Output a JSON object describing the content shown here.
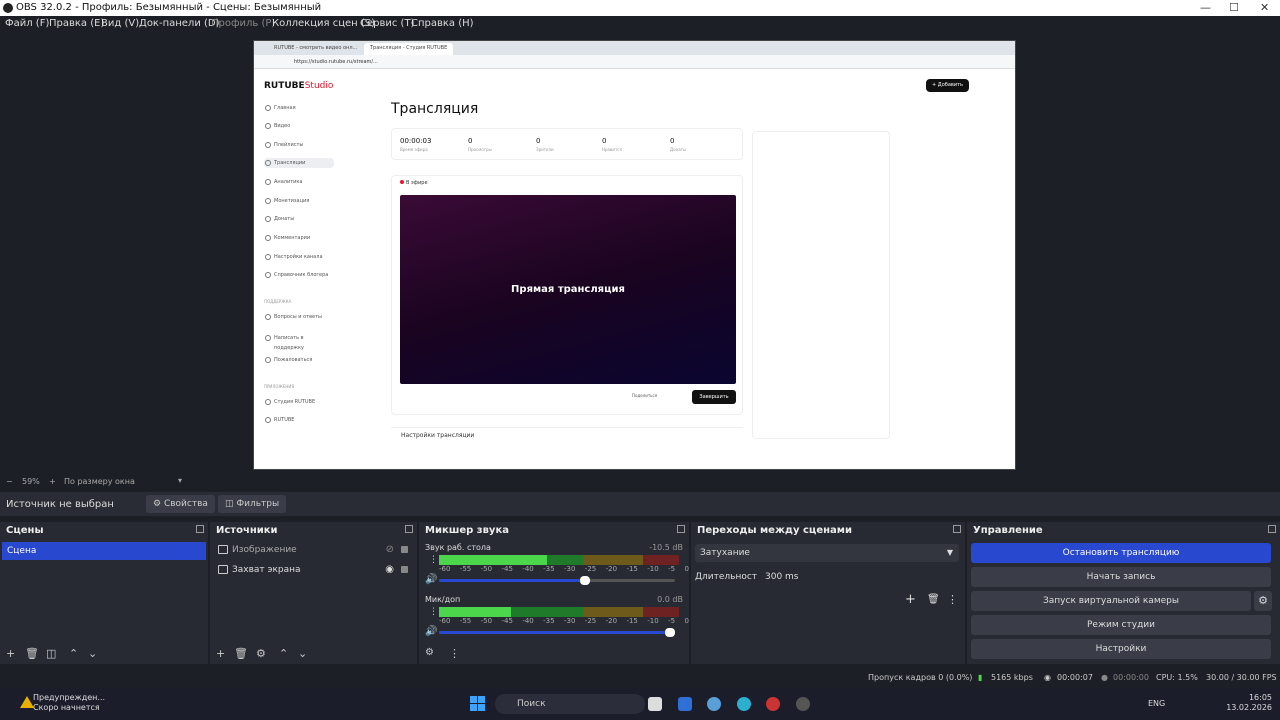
{
  "window": {
    "title": "OBS 32.0.2 - Профиль: Безымянный - Сцены: Безымянный"
  },
  "menu": [
    "Файл (F)",
    "Правка (E)",
    "Вид (V)",
    "Док-панели (D)",
    "Профиль (P)",
    "Коллекция сцен (S)",
    "Сервис (T)",
    "Справка (H)"
  ],
  "preview": {
    "browser_tab1": "RUTUBE - смотреть видео онл...",
    "browser_tab2": "Трансляция - Студия RUTUBE",
    "url": "https://studio.rutube.ru/stream/...",
    "logo_main": "RUTUBE",
    "logo_accent": "Studio",
    "add_button": "+ Добавить",
    "sidebar": [
      "Главная",
      "Видео",
      "Плейлисты",
      "Трансляции",
      "Аналитика",
      "Монетизация",
      "Донаты",
      "Комментарии",
      "Настройки канала",
      "Справочник блогера"
    ],
    "support_head": "ПОДДЕРЖКА",
    "support": [
      "Вопросы и ответы",
      "Написать в поддержку",
      "Пожаловаться"
    ],
    "apps_head": "ПРИЛОЖЕНИЯ",
    "apps": [
      "Студия RUTUBE",
      "RUTUBE"
    ],
    "page_title": "Трансляция",
    "stats": [
      {
        "value": "00:00:03",
        "label": "Время эфира"
      },
      {
        "value": "0",
        "label": "Просмотры"
      },
      {
        "value": "0",
        "label": "Зрители"
      },
      {
        "value": "0",
        "label": "Нравится"
      },
      {
        "value": "0",
        "label": "Донаты"
      }
    ],
    "live_label": "В эфире",
    "video_text": "Прямая трансляция",
    "share": "Поделиться",
    "end": "Завершить",
    "settings_row": "Настройки трансляции"
  },
  "zoom": {
    "percent": "59%",
    "mode": "По размеру окна"
  },
  "source_bar": {
    "no_source": "Источник не выбран",
    "properties": "Свойства",
    "filters": "Фильтры"
  },
  "scenes": {
    "title": "Сцены",
    "items": [
      "Сцена"
    ]
  },
  "sources": {
    "title": "Источники",
    "items": [
      {
        "name": "Изображение",
        "visible": false
      },
      {
        "name": "Захват экрана",
        "visible": true
      }
    ]
  },
  "mixer": {
    "title": "Микшер звука",
    "ticks": [
      "-60",
      "-55",
      "-50",
      "-45",
      "-40",
      "-35",
      "-30",
      "-25",
      "-20",
      "-15",
      "-10",
      "-5",
      "0"
    ],
    "channels": [
      {
        "name": "Звук раб. стола",
        "db": "-10.5 dB",
        "level": 0.45,
        "volume": 0.64
      },
      {
        "name": "Мик/доп",
        "db": "0.0 dB",
        "level": 0.3,
        "volume": 1.0
      }
    ]
  },
  "transitions": {
    "title": "Переходы между сценами",
    "selected": "Затухание",
    "duration_label": "Длительность",
    "duration": "300 ms"
  },
  "controls": {
    "title": "Управление",
    "buttons": [
      "Остановить трансляцию",
      "Начать запись",
      "Запуск виртуальной камеры",
      "Режим студии",
      "Настройки"
    ]
  },
  "status": {
    "dropped": "Пропуск кадров 0 (0.0%)",
    "bitrate": "5165 kbps",
    "stream_time": "00:00:07",
    "rec_time": "00:00:00",
    "cpu": "CPU: 1.5%",
    "fps": "30.00 / 30.00 FPS"
  },
  "taskbar": {
    "notif_line1": "Предупрежден...",
    "notif_line2": "Скоро начнется",
    "search": "Поиск",
    "lang": "ENG",
    "time": "16:05",
    "date": "13.02.2026"
  },
  "colors": {
    "accent": "#2848d0",
    "background": "#1d1f26",
    "dock": "#272a33",
    "rutube_red": "#e5172f"
  }
}
